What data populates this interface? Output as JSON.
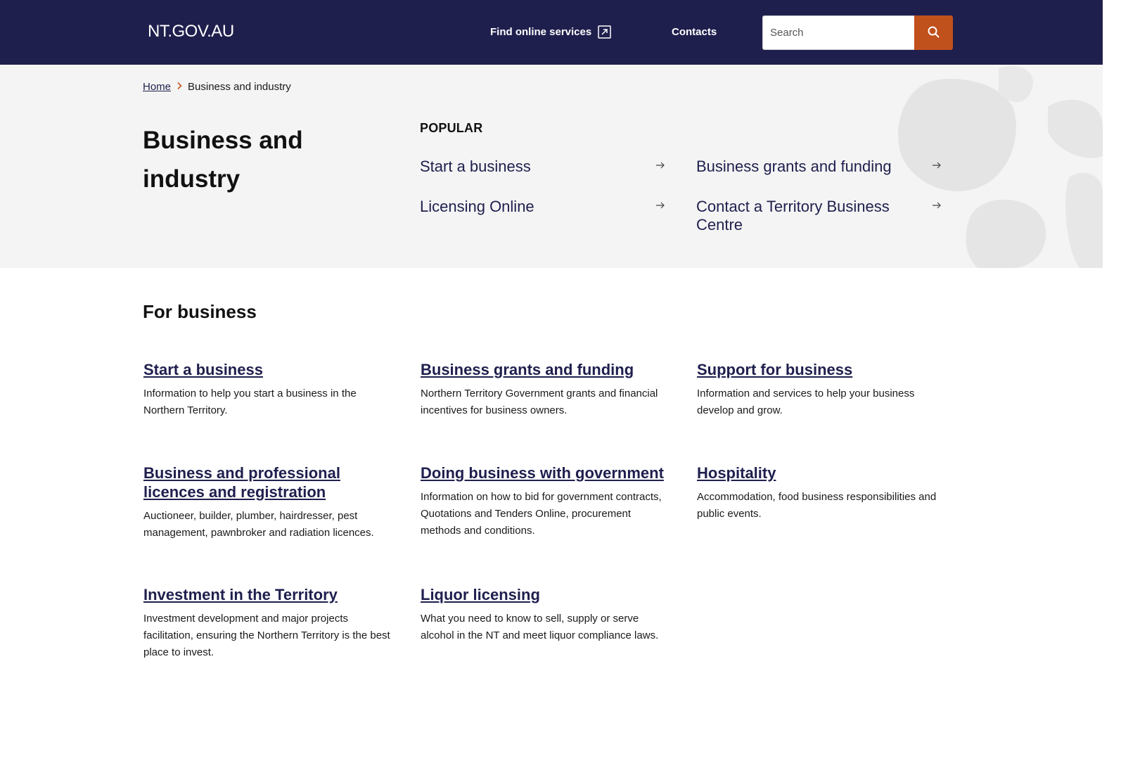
{
  "header": {
    "logo": "NT.GOV.AU",
    "nav": {
      "online_services": "Find online services",
      "contacts": "Contacts"
    },
    "search": {
      "placeholder": "Search"
    }
  },
  "breadcrumb": {
    "home": "Home",
    "current": "Business and industry"
  },
  "page": {
    "title": "Business and industry"
  },
  "popular": {
    "heading": "POPULAR",
    "links": [
      {
        "label": "Start a business"
      },
      {
        "label": "Business grants and funding"
      },
      {
        "label": "Licensing Online"
      },
      {
        "label": "Contact a Territory Business Centre"
      }
    ]
  },
  "for_business": {
    "heading": "For business",
    "cards": [
      {
        "title": "Start a business",
        "desc": "Information to help you start a business in the Northern Territory."
      },
      {
        "title": "Business grants and funding",
        "desc": "Northern Territory Government grants and financial incentives for business owners."
      },
      {
        "title": "Support for business",
        "desc": "Information and services to help your business develop and grow."
      },
      {
        "title": "Business and professional licences and registration",
        "desc": "Auctioneer, builder, plumber, hairdresser, pest management, pawnbroker and radiation licences."
      },
      {
        "title": "Doing business with government",
        "desc": "Information on how to bid for government contracts, Quotations and Tenders Online, procurement methods and conditions."
      },
      {
        "title": "Hospitality",
        "desc": "Accommodation, food business responsibilities and public events."
      },
      {
        "title": "Investment in the Territory",
        "desc": "Investment development and major projects facilitation, ensuring the Northern Territory is the best place to invest."
      },
      {
        "title": "Liquor licensing",
        "desc": "What you need to know to sell, supply or serve alcohol in the NT and meet liquor compliance laws."
      }
    ]
  },
  "icons": {
    "external_link": "external-link-icon",
    "search": "search-icon",
    "breadcrumb_separator": "chevron-right-icon",
    "link_arrow": "arrow-right-icon"
  },
  "colors": {
    "header_bg": "#1f1f4e",
    "accent": "#c0501c",
    "link": "#1f1f4e",
    "hero_bg": "#f4f4f4"
  }
}
